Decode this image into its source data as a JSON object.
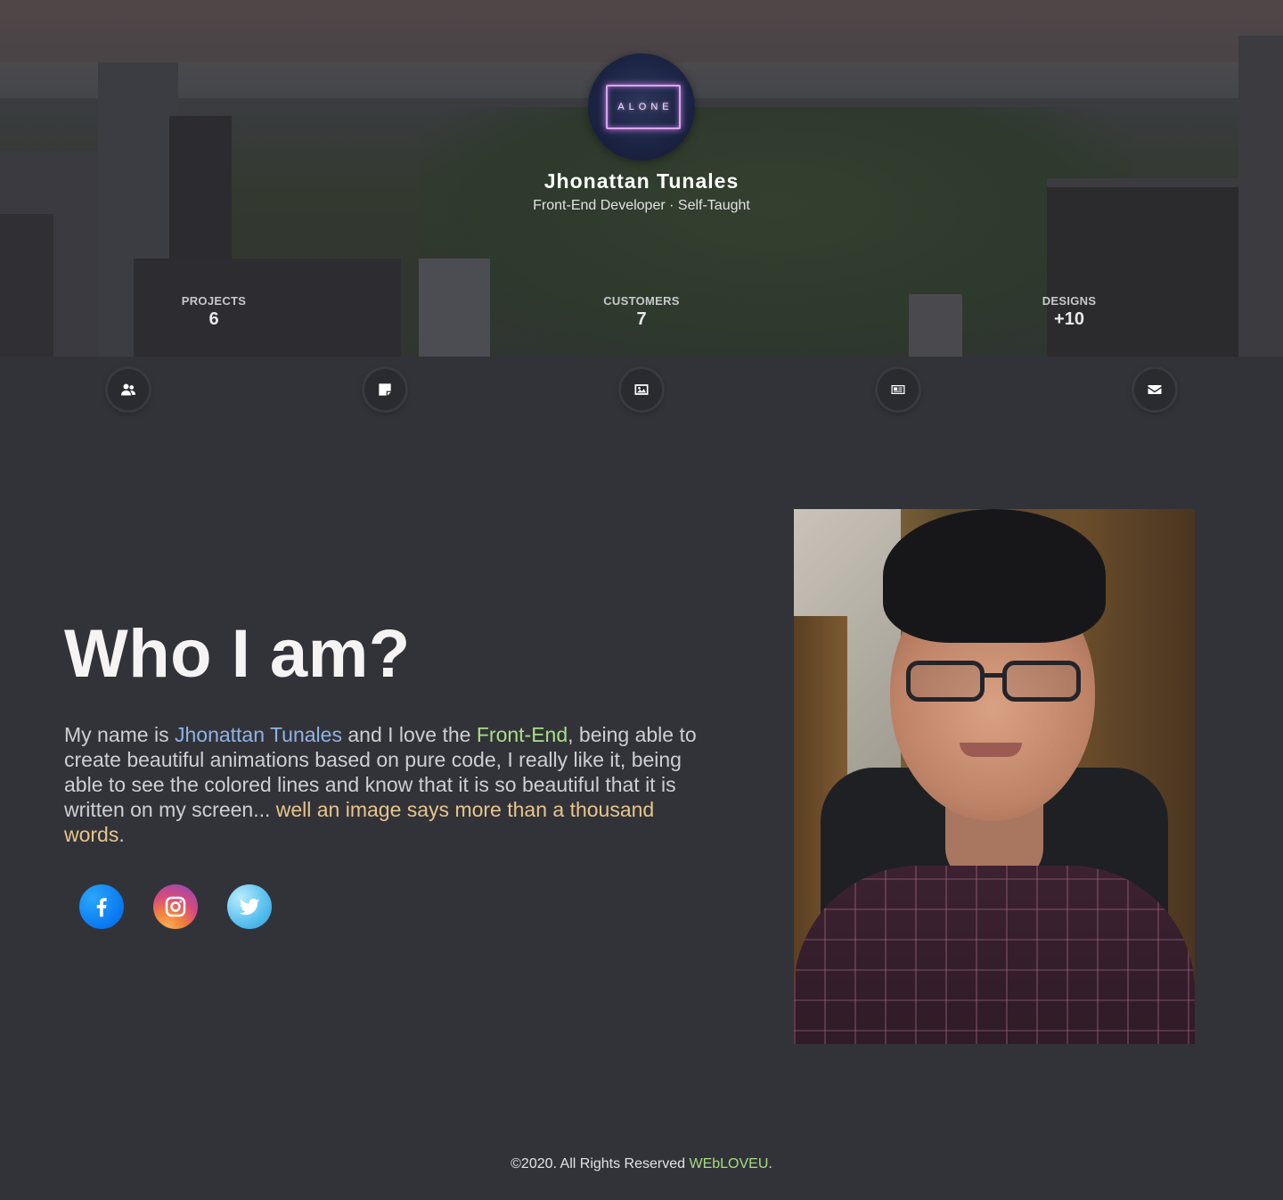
{
  "hero": {
    "avatar_text": "ALONE",
    "name": "Jhonattan Tunales",
    "role": "Front-End Developer · Self-Taught",
    "stats": [
      {
        "label": "PROJECTS",
        "value": "6"
      },
      {
        "label": "CUSTOMERS",
        "value": "7"
      },
      {
        "label": "DESIGNS",
        "value": "+10"
      }
    ]
  },
  "nav": {
    "icons": [
      "users-icon",
      "sticky-note-icon",
      "image-icon",
      "newspaper-icon",
      "envelope-icon"
    ]
  },
  "about": {
    "title": "Who I am?",
    "text_1": "My name is ",
    "name": "Jhonattan Tunales",
    "text_2": " and I love the ",
    "front": "Front-End",
    "text_3": ", being able to create beautiful animations based on pure code, I really like it, being able to see the colored lines and know that it is so beautiful that it is written on my screen... ",
    "quote": "well an image says more than a thousand words",
    "text_4": ".",
    "social": [
      "facebook-icon",
      "instagram-icon",
      "twitter-icon"
    ]
  },
  "footer": {
    "text": "©2020. All Rights Reserved ",
    "brand": "WEbLOVEU",
    "end": "."
  },
  "colors": {
    "background": "#323338",
    "name_highlight": "#8fb3e6",
    "front_highlight": "#a8df88",
    "quote_highlight": "#e7c58d",
    "brand": "#a6dd87"
  }
}
